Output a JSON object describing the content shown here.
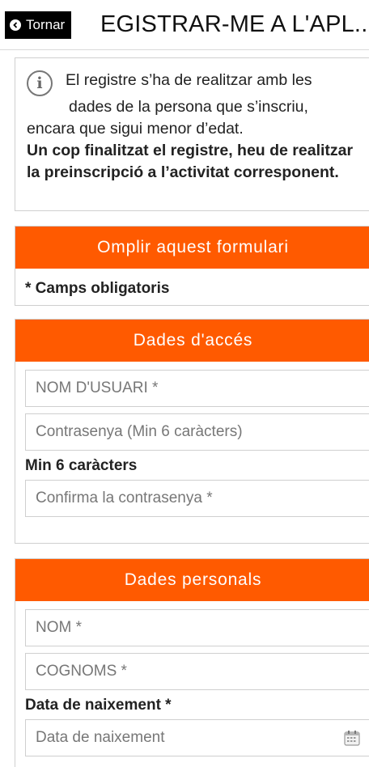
{
  "header": {
    "back_label": "Tornar",
    "title": "EGISTRAR-ME A L'APL..."
  },
  "info": {
    "line1": "El registre s’ha de realitzar amb les",
    "line2": "dades de la persona que s’inscriu,",
    "line3": "encara que sigui menor d’edat.",
    "bold": "Un cop finalitzat el registre, heu de realitzar la preinscripció a l’activitat corresponent."
  },
  "form_intro": {
    "header": "Omplir aquest formulari",
    "required_note": "* Camps obligatoris"
  },
  "access": {
    "header": "Dades d'accés",
    "username_placeholder": "NOM D'USUARI *",
    "password_placeholder": "Contrasenya (Min 6 caràcters)",
    "password_hint": "Min 6 caràcters",
    "confirm_placeholder": "Confirma la contrasenya *"
  },
  "personal": {
    "header": "Dades personals",
    "name_placeholder": "NOM *",
    "surname_placeholder": "COGNOMS *",
    "birth_label": "Data de naixement *",
    "birth_placeholder": "Data de naixement"
  },
  "colors": {
    "accent": "#ff5a00",
    "header_button": "#000000"
  }
}
